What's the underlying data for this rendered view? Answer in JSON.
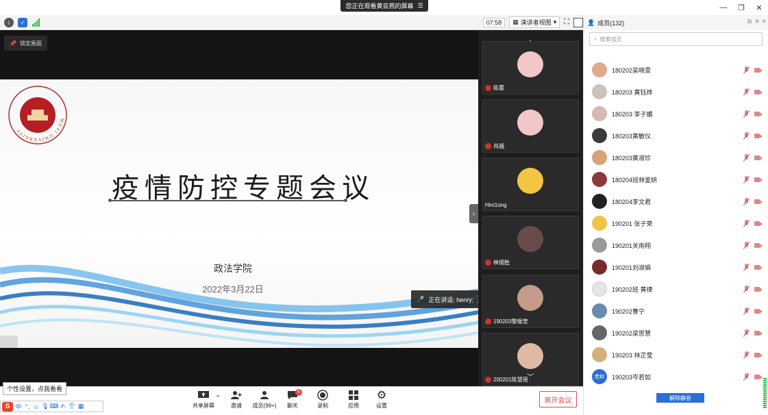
{
  "titlebar": {
    "share_banner": "您正在观看黄亚燕的屏幕",
    "controls": [
      "minimize",
      "restore",
      "close"
    ]
  },
  "toolbar": {
    "timer": "07:58",
    "view_mode": "演讲者视图"
  },
  "main": {
    "lock_label": "锁定画面",
    "slide": {
      "logo_ring_text": "WUYI UNIVERSITY",
      "title": "疫情防控专题会议",
      "department": "政法学院",
      "date": "2022年3月22日"
    },
    "speaking": "正在讲话: henry;"
  },
  "strip": {
    "tiles": [
      {
        "name": "陈蕾",
        "avatar_color": "#f2c7c7"
      },
      {
        "name": "肖越",
        "avatar_color": "#f2c7c7"
      },
      {
        "name": "Hini1ong",
        "avatar_color": "#f4c542"
      },
      {
        "name": "林熠胜",
        "avatar_color": "#6a4a4a"
      },
      {
        "name": "190203黎佩莹",
        "avatar_color": "#c49a8a"
      },
      {
        "name": "200201陈慧瑶",
        "avatar_color": "#e0b9a4"
      }
    ]
  },
  "panel": {
    "title": "成员(132)",
    "search_placeholder": "搜索成员",
    "members": [
      {
        "name": "180202吴晓雯",
        "color": "#e3a98c"
      },
      {
        "name": "180203 黄钰烨",
        "color": "#c9c3b9"
      },
      {
        "name": "180203 李子媚",
        "color": "#d6b8b0"
      },
      {
        "name": "180203黄敏仪",
        "color": "#3a3a3a"
      },
      {
        "name": "180203黄淑珍",
        "color": "#d9a27a"
      },
      {
        "name": "180204班林鉴妍",
        "color": "#8a3a3a"
      },
      {
        "name": "180204李文君",
        "color": "#222222"
      },
      {
        "name": "190201 张子荣",
        "color": "#f0c24a"
      },
      {
        "name": "190201关雨翔",
        "color": "#9a9a9a"
      },
      {
        "name": "190201刘淑娟",
        "color": "#7a2a2a"
      },
      {
        "name": "190202班 黄律",
        "color": "#e5e5e5"
      },
      {
        "name": "190202曹宁",
        "color": "#6a8ab0"
      },
      {
        "name": "190202梁思慧",
        "color": "#666666"
      },
      {
        "name": "190203 林芷莹",
        "color": "#d4b07a"
      },
      {
        "name": "190203岑若如",
        "color": "#2b6fd6",
        "initials": "若如"
      }
    ],
    "unmute_all": "解除静音"
  },
  "controls": {
    "share": "共享屏幕",
    "invite": "邀请",
    "members": "成员(99+)",
    "chat": "聊天",
    "chat_badge": "5",
    "record": "录制",
    "apps": "应用",
    "settings": "设置",
    "leave": "离开会议"
  },
  "tooltip": "个性设置，点我看看",
  "ime": {
    "logo": "S",
    "lang": "中"
  }
}
